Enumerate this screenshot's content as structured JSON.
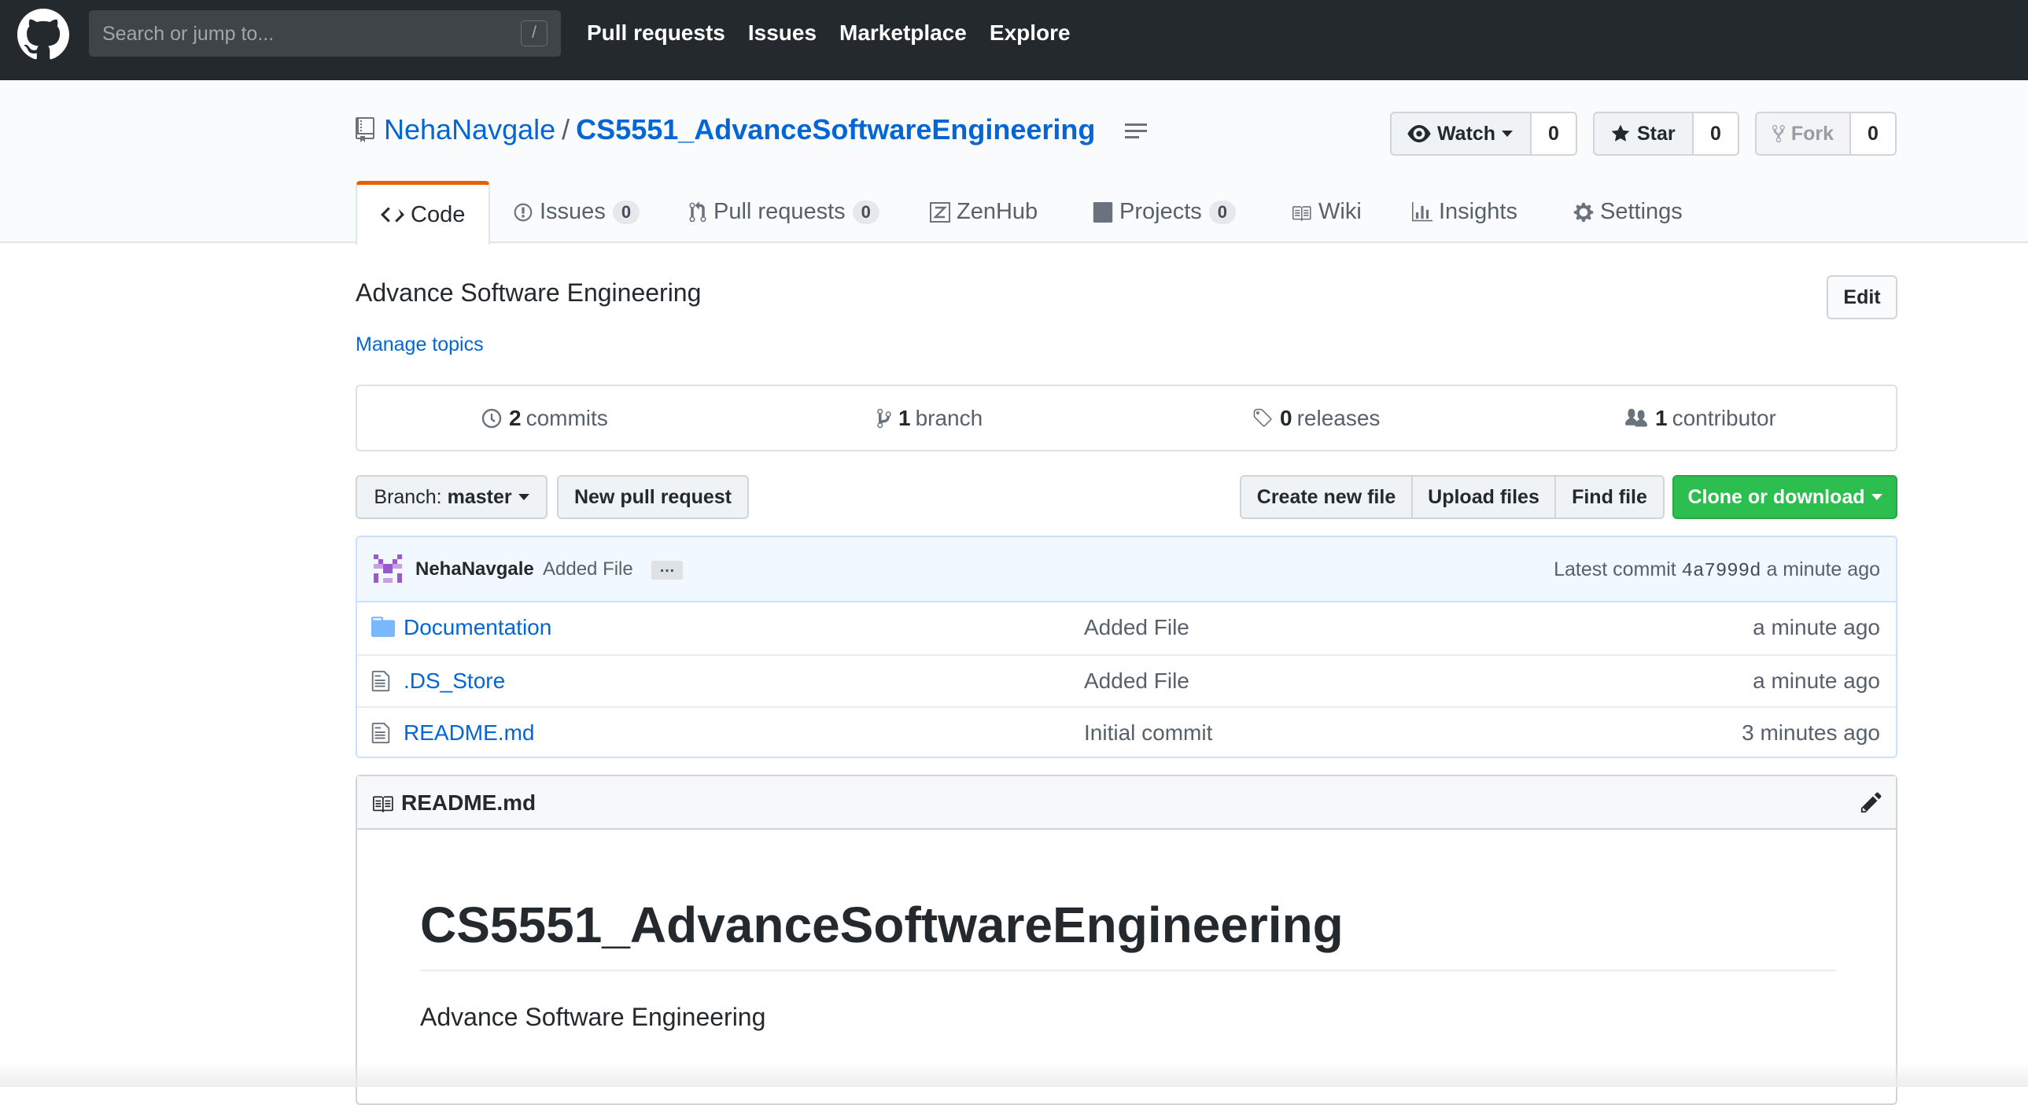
{
  "header": {
    "search_placeholder": "Search or jump to...",
    "search_shortcut": "/",
    "nav": [
      "Pull requests",
      "Issues",
      "Marketplace",
      "Explore"
    ]
  },
  "repo": {
    "owner": "NehaNavgale",
    "separator": "/",
    "name": "CS5551_AdvanceSoftwareEngineering",
    "watch_label": "Watch",
    "watch_count": "0",
    "star_label": "Star",
    "star_count": "0",
    "fork_label": "Fork",
    "fork_count": "0"
  },
  "tabs": [
    {
      "label": "Code",
      "icon": "code-icon",
      "selected": true
    },
    {
      "label": "Issues",
      "icon": "issue-opened-icon",
      "count": "0"
    },
    {
      "label": "Pull requests",
      "icon": "git-pull-request-icon",
      "count": "0"
    },
    {
      "label": "ZenHub",
      "icon": "zenhub-icon"
    },
    {
      "label": "Projects",
      "icon": "project-icon",
      "count": "0"
    },
    {
      "label": "Wiki",
      "icon": "book-icon"
    },
    {
      "label": "Insights",
      "icon": "graph-icon"
    },
    {
      "label": "Settings",
      "icon": "gear-icon"
    }
  ],
  "about": {
    "description": "Advance Software Engineering",
    "manage_topics": "Manage topics",
    "edit_label": "Edit"
  },
  "summary": {
    "commits_count": "2",
    "commits_label": "commits",
    "branch_count": "1",
    "branch_label": "branch",
    "releases_count": "0",
    "releases_label": "releases",
    "contributor_count": "1",
    "contributor_label": "contributor"
  },
  "toolbar": {
    "branch_prefix": "Branch:",
    "branch_name": "master",
    "new_pull_request": "New pull request",
    "create_new_file": "Create new file",
    "upload_files": "Upload files",
    "find_file": "Find file",
    "clone_or_download": "Clone or download"
  },
  "commit": {
    "author": "NehaNavgale",
    "message": "Added File",
    "ellipsis": "…",
    "latest_label": "Latest commit",
    "sha": "4a7999d",
    "age": "a minute ago"
  },
  "files": [
    {
      "type": "directory",
      "icon": "file-directory-icon",
      "name": "Documentation",
      "message": "Added File",
      "age": "a minute ago"
    },
    {
      "type": "file",
      "icon": "file-icon",
      "name": ".DS_Store",
      "message": "Added File",
      "age": "a minute ago"
    },
    {
      "type": "file",
      "icon": "file-icon",
      "name": "README.md",
      "message": "Initial commit",
      "age": "3 minutes ago"
    }
  ],
  "readme": {
    "filename": "README.md",
    "heading": "CS5551_AdvanceSoftwareEngineering",
    "body": "Advance Software Engineering"
  },
  "colors": {
    "header_bg": "#24292e",
    "link": "#0366d6",
    "selected_tab_accent": "#e36209",
    "clone_button": "#2cbe4e",
    "commit_bar_bg": "#f1f8ff"
  }
}
